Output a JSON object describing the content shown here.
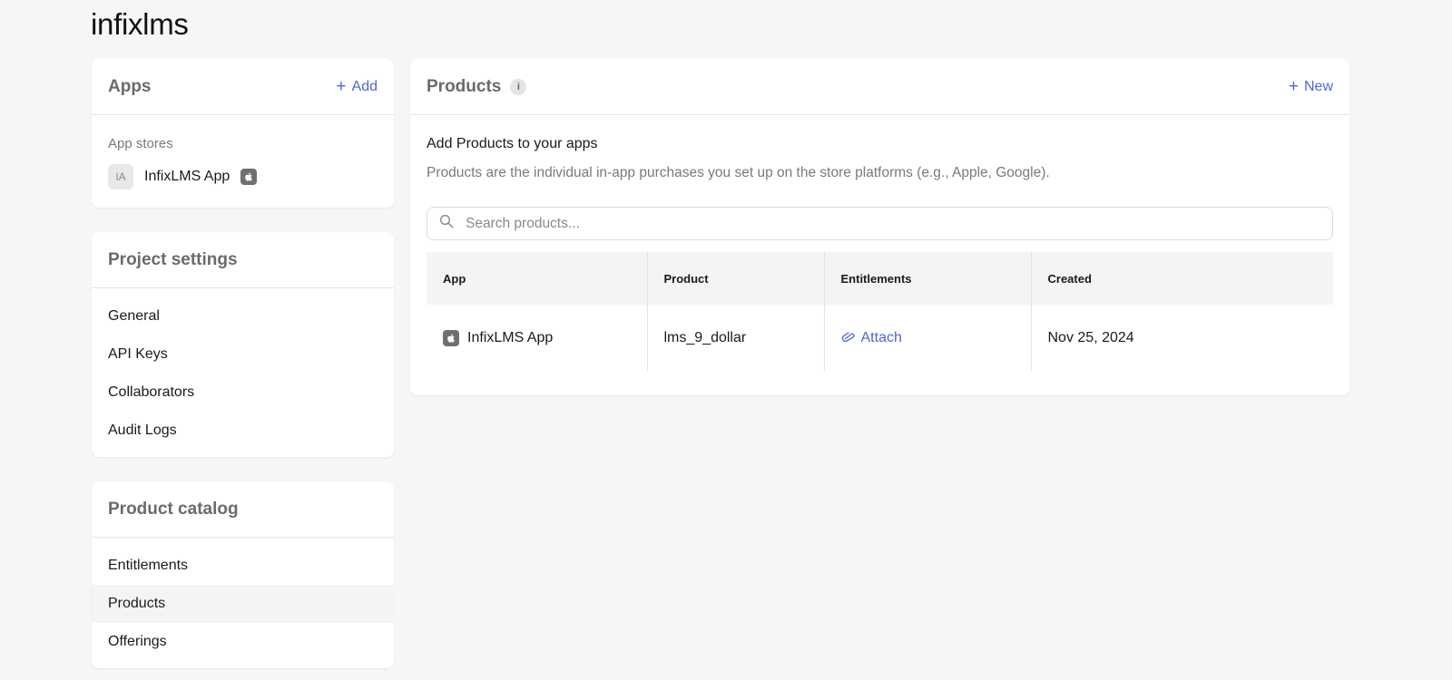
{
  "project": {
    "title": "infixlms"
  },
  "apps": {
    "title": "Apps",
    "add_label": "Add",
    "section_label": "App stores",
    "items": [
      {
        "avatar": "IA",
        "name": "InfixLMS App",
        "store_icon": "apple-icon"
      }
    ]
  },
  "settings": {
    "title": "Project settings",
    "items": [
      {
        "label": "General"
      },
      {
        "label": "API Keys"
      },
      {
        "label": "Collaborators"
      },
      {
        "label": "Audit Logs"
      }
    ]
  },
  "catalog": {
    "title": "Product catalog",
    "items": [
      {
        "label": "Entitlements",
        "active": false
      },
      {
        "label": "Products",
        "active": true
      },
      {
        "label": "Offerings",
        "active": false
      }
    ]
  },
  "products": {
    "title": "Products",
    "info_glyph": "i",
    "new_label": "New",
    "heading": "Add Products to your apps",
    "description": "Products are the individual in-app purchases you set up on the store platforms (e.g., Apple, Google).",
    "search_placeholder": "Search products...",
    "columns": [
      "App",
      "Product",
      "Entitlements",
      "Created"
    ],
    "rows": [
      {
        "app": "InfixLMS App",
        "product": "lms_9_dollar",
        "entitlements": "Attach",
        "created": "Nov 25, 2024"
      }
    ]
  },
  "colors": {
    "accent": "#4f67cf",
    "background": "#f6f6f6",
    "active_row": "#f4f4f4"
  }
}
